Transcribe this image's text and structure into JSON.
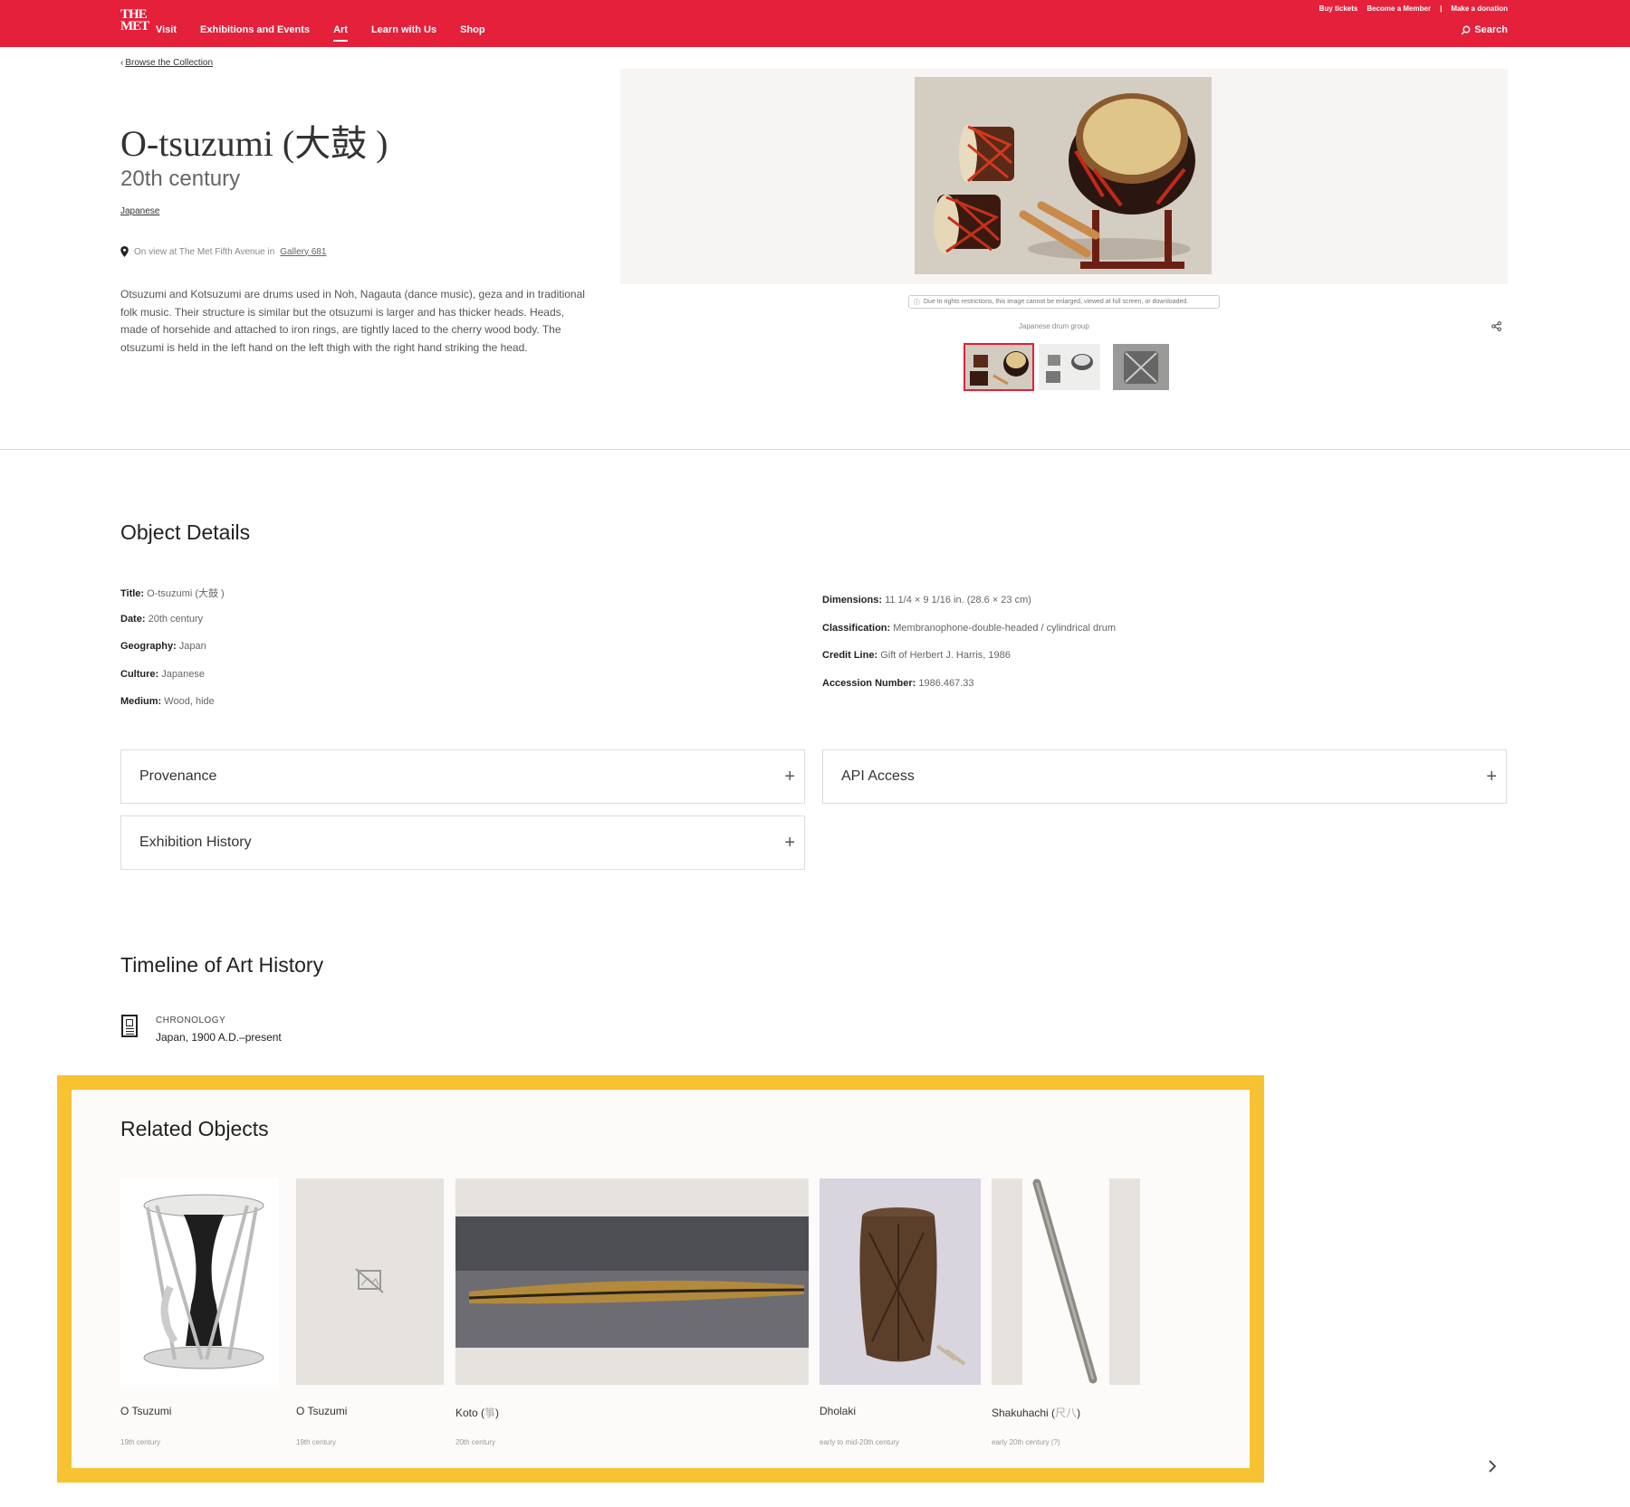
{
  "header": {
    "logo": "THE MET",
    "nav": [
      "Visit",
      "Exhibitions and Events",
      "Art",
      "Learn with Us",
      "Shop"
    ],
    "active_nav": "Art",
    "utility": [
      "Buy tickets",
      "Become a Member",
      "|",
      "Make a donation"
    ],
    "search": "Search"
  },
  "breadcrumb": "Browse the Collection",
  "object": {
    "title": "O-tsuzumi (大鼓 )",
    "date": "20th century",
    "culture_link": "Japanese",
    "on_view": "On view at The Met Fifth Avenue in",
    "gallery": "Gallery 681",
    "description": "Otsuzumi and Kotsuzumi are drums used in Noh, Nagauta (dance music), geza and in traditional folk music. Their structure is similar but the otsuzumi is larger and has thicker heads. Heads, made of horsehide and attached to iron rings, are tightly laced to the cherry wood body. The otsuzumi is held in the left hand on the left thigh with the right hand striking the head."
  },
  "image": {
    "notice": "Due to rights restrictions, this image cannot be enlarged, viewed at full screen, or downloaded.",
    "caption": "Japanese drum group",
    "thumbnail_count": 3
  },
  "details": {
    "heading": "Object Details",
    "left": [
      {
        "label": "Title:",
        "value": "O-tsuzumi (大鼓 )"
      },
      {
        "label": "Date:",
        "value": "20th century"
      },
      {
        "label": "Geography:",
        "value": "Japan"
      },
      {
        "label": "Culture:",
        "value": "Japanese"
      },
      {
        "label": "Medium:",
        "value": "Wood, hide"
      }
    ],
    "right": [
      {
        "label": "Dimensions:",
        "value": "11 1/4 × 9 1/16 in. (28.6 × 23 cm)"
      },
      {
        "label": "Classification:",
        "value": "Membranophone-double-headed / cylindrical drum"
      },
      {
        "label": "Credit Line:",
        "value": "Gift of Herbert J. Harris, 1986"
      },
      {
        "label": "Accession Number:",
        "value": "1986.467.33"
      }
    ],
    "accordions": [
      "Provenance",
      "API Access",
      "Exhibition History"
    ]
  },
  "timeline": {
    "heading": "Timeline of Art History",
    "label": "CHRONOLOGY",
    "value": "Japan, 1900 A.D.–present"
  },
  "related": {
    "heading": "Related Objects",
    "items": [
      {
        "title": "O Tsuzumi",
        "cjk": "",
        "date": "19th century"
      },
      {
        "title": "O Tsuzumi",
        "cjk": "",
        "date": "19th century"
      },
      {
        "title": "Koto (",
        "cjk": "箏",
        "close": ")",
        "date": "20th century"
      },
      {
        "title": "Dholaki",
        "cjk": "",
        "date": "early to mid-20th century"
      },
      {
        "title": "Shakuhachi (",
        "cjk": "尺八",
        "close": ")",
        "date": "early 20th century (?)"
      }
    ]
  },
  "colors": {
    "brand": "#e4203a",
    "highlight": "#f8c332"
  }
}
